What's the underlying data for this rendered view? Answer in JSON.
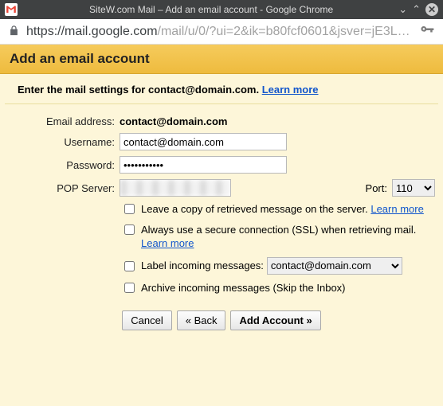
{
  "window": {
    "title": "SiteW.com Mail – Add an email account - Google Chrome"
  },
  "address": {
    "host": "https://mail.google.com",
    "path": "/mail/u/0/?ui=2&ik=b80fcf0601&jsver=jE3LoW..."
  },
  "header": {
    "title": "Add an email account"
  },
  "subhead": {
    "prefix": "Enter the mail settings for ",
    "email": "contact@domain.com",
    "suffix": ". ",
    "learn": "Learn more"
  },
  "labels": {
    "email": "Email address:",
    "username": "Username:",
    "password": "Password:",
    "pop": "POP Server:",
    "port": "Port:"
  },
  "values": {
    "email": "contact@domain.com",
    "username": "contact@domain.com",
    "password": "•••••••••••",
    "port": "110"
  },
  "checks": {
    "leave_copy": "Leave a copy of retrieved message on the server.",
    "ssl": "Always use a secure connection (SSL) when retrieving mail.",
    "label_incoming": "Label incoming messages:",
    "label_value": "contact@domain.com",
    "archive": "Archive incoming messages (Skip the Inbox)",
    "learn": "Learn more"
  },
  "buttons": {
    "cancel": "Cancel",
    "back": "« Back",
    "add": "Add Account »"
  }
}
